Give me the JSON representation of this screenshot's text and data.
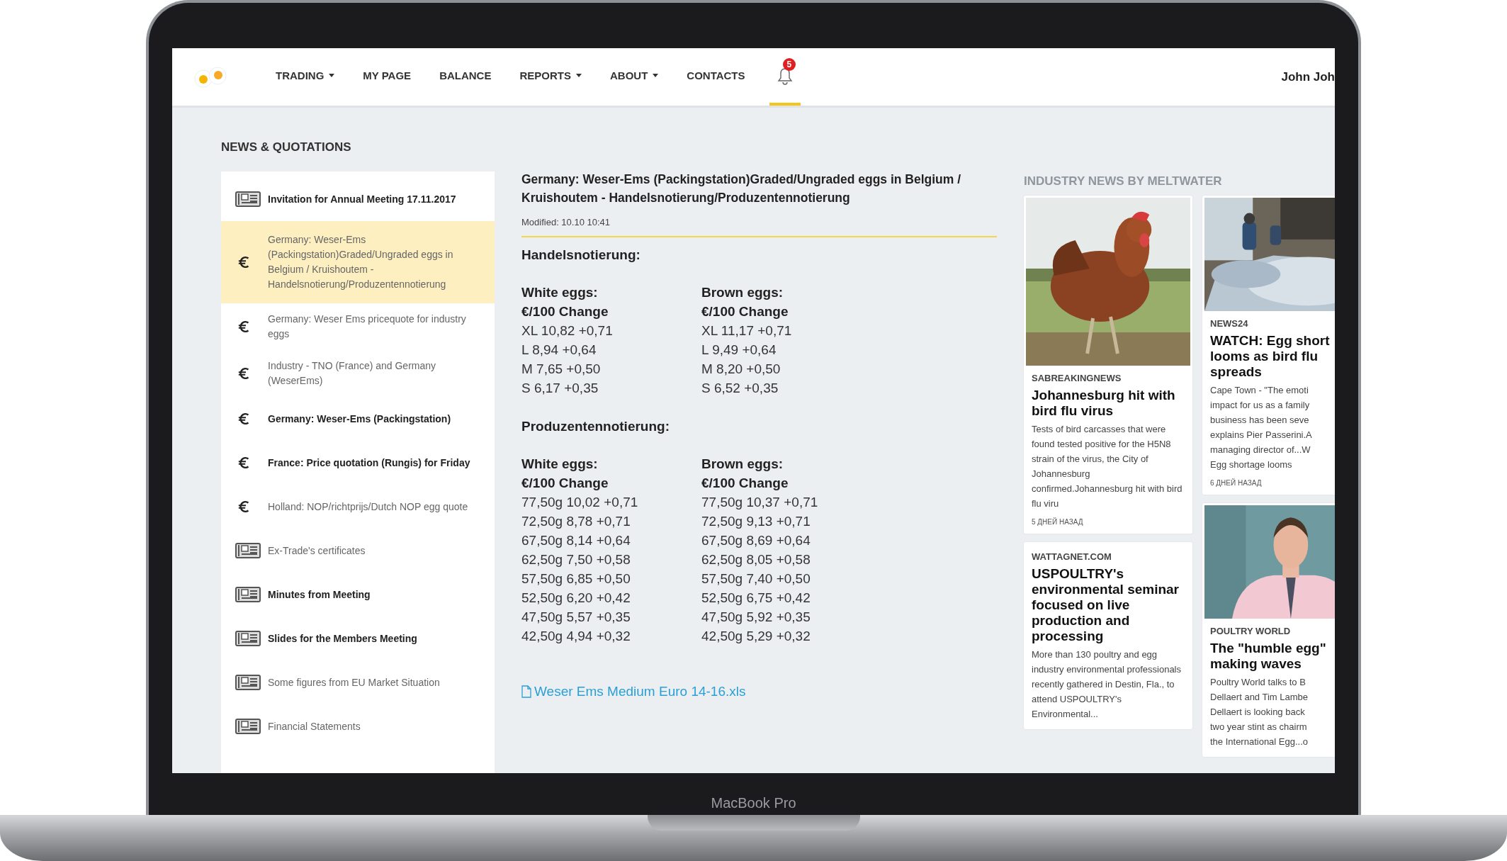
{
  "device": {
    "label": "MacBook Pro"
  },
  "nav": {
    "items": [
      {
        "label": "TRADING",
        "dropdown": true,
        "selected": false
      },
      {
        "label": "MY PAGE",
        "dropdown": false,
        "selected": false
      },
      {
        "label": "BALANCE",
        "dropdown": false,
        "selected": false
      },
      {
        "label": "REPORTS",
        "dropdown": true,
        "selected": false
      },
      {
        "label": "ABOUT",
        "dropdown": true,
        "selected": false
      },
      {
        "label": "CONTACTS",
        "dropdown": false,
        "selected": false
      }
    ],
    "notifications": {
      "badge": "5",
      "selected": true
    },
    "user": "John Joh"
  },
  "sidebar": {
    "title": "NEWS & QUOTATIONS",
    "items": [
      {
        "kind": "document",
        "label": "Invitation for Annual Meeting 17.11.2017",
        "unread": true,
        "selected": false
      },
      {
        "kind": "quote",
        "label": "Germany: Weser-Ems (Packingstation)Graded/Ungraded eggs in Belgium / Kruishoutem - Handelsnotierung/Produzentennotierung",
        "unread": false,
        "selected": true
      },
      {
        "kind": "quote",
        "label": "Germany: Weser Ems pricequote for industry eggs",
        "unread": false,
        "selected": false
      },
      {
        "kind": "quote",
        "label": "Industry - TNO (France) and Germany (WeserEms)",
        "unread": false,
        "selected": false
      },
      {
        "kind": "quote",
        "label": "Germany: Weser-Ems (Packingstation)",
        "unread": true,
        "selected": false
      },
      {
        "kind": "quote",
        "label": "France: Price quotation (Rungis) for Friday",
        "unread": true,
        "selected": false
      },
      {
        "kind": "quote",
        "label": "Holland: NOP/richtprijs/Dutch NOP egg quote",
        "unread": false,
        "selected": false
      },
      {
        "kind": "document",
        "label": "Ex-Trade's certificates",
        "unread": false,
        "selected": false
      },
      {
        "kind": "document",
        "label": "Minutes from Meeting",
        "unread": true,
        "selected": false
      },
      {
        "kind": "document",
        "label": "Slides for the Members Meeting",
        "unread": true,
        "selected": false
      },
      {
        "kind": "document",
        "label": "Some figures from EU Market Situation",
        "unread": false,
        "selected": false
      },
      {
        "kind": "document",
        "label": "Financial Statements",
        "unread": false,
        "selected": false
      }
    ]
  },
  "article": {
    "title": "Germany: Weser-Ems (Packingstation)Graded/Ungraded eggs in Belgium / Kruishoutem - Handelsnotierung/Produzentennotierung",
    "modified": "Modified:  10.10 10:41",
    "sections": [
      {
        "heading": "Handelsnotierung:",
        "columns": [
          {
            "heading": "White eggs:",
            "subheading": "€/100 Change",
            "rows": [
              "XL 10,82 +0,71",
              "L 8,94 +0,64",
              "M 7,65 +0,50",
              "S 6,17 +0,35"
            ]
          },
          {
            "heading": "Brown eggs:",
            "subheading": "€/100 Change",
            "rows": [
              "XL 11,17 +0,71",
              "L 9,49 +0,64",
              "M 8,20 +0,50",
              "S 6,52 +0,35"
            ]
          }
        ]
      },
      {
        "heading": "Produzentennotierung:",
        "columns": [
          {
            "heading": "White eggs:",
            "subheading": "€/100 Change",
            "rows": [
              "77,50g 10,02 +0,71",
              "72,50g 8,78 +0,71",
              "67,50g 8,14 +0,64",
              "62,50g 7,50 +0,58",
              "57,50g 6,85 +0,50",
              "52,50g 6,20 +0,42",
              "47,50g 5,57 +0,35",
              "42,50g 4,94 +0,32"
            ]
          },
          {
            "heading": "Brown eggs:",
            "subheading": "€/100 Change",
            "rows": [
              "77,50g 10,37 +0,71",
              "72,50g 9,13 +0,71",
              "67,50g 8,69 +0,64",
              "62,50g 8,05 +0,58",
              "57,50g 7,40 +0,50",
              "52,50g 6,75 +0,42",
              "47,50g 5,92 +0,35",
              "42,50g 5,29 +0,32"
            ]
          }
        ]
      }
    ],
    "attachment": "Weser Ems Medium Euro 14-16.xls"
  },
  "news": {
    "title": "INDUSTRY NEWS BY MELTWATER",
    "columns": [
      [
        {
          "image": {
            "kind": "picture"
          },
          "source": "SABREAKINGNEWS",
          "headline": [
            "Johannesburg hit with bird flu virus"
          ],
          "body": [
            "Tests of bird carcasses that were found tested positive for the H5N8 strain of the virus, the City of Johannesburg confirmed.Johannesburg hit with bird flu viru"
          ],
          "time": "5 ДНЕЙ НАЗАД"
        },
        {
          "source": "WATTAGNET.COM",
          "headline": [
            "USPOULTRY's environmental seminar focused on live production and processing"
          ],
          "body": [
            "More than 130 poultry and egg industry environmental professionals recently gathered in Destin, Fla., to attend USPOULTRY's Environmental..."
          ]
        }
      ],
      [
        {
          "image": {
            "kind": "picture"
          },
          "source": "NEWS24",
          "headline": [
            "WATCH: Egg short",
            "looms as bird flu",
            "spreads"
          ],
          "body": [
            "Cape Town - \"The emoti",
            "impact for us as a family",
            "business has been seve",
            "explains Pier Passerini.A",
            "managing director of...W",
            "Egg shortage looms"
          ],
          "time": "6 ДНЕЙ НАЗАД"
        },
        {
          "image": {
            "kind": "picture"
          },
          "source": "POULTRY WORLD",
          "headline": [
            "The \"humble egg\"",
            "making waves"
          ],
          "body": [
            "Poultry World talks to B",
            "Dellaert and Tim Lambe",
            "Dellaert is looking back",
            "two year stint as chairm",
            "the International Egg...o"
          ]
        }
      ]
    ]
  }
}
